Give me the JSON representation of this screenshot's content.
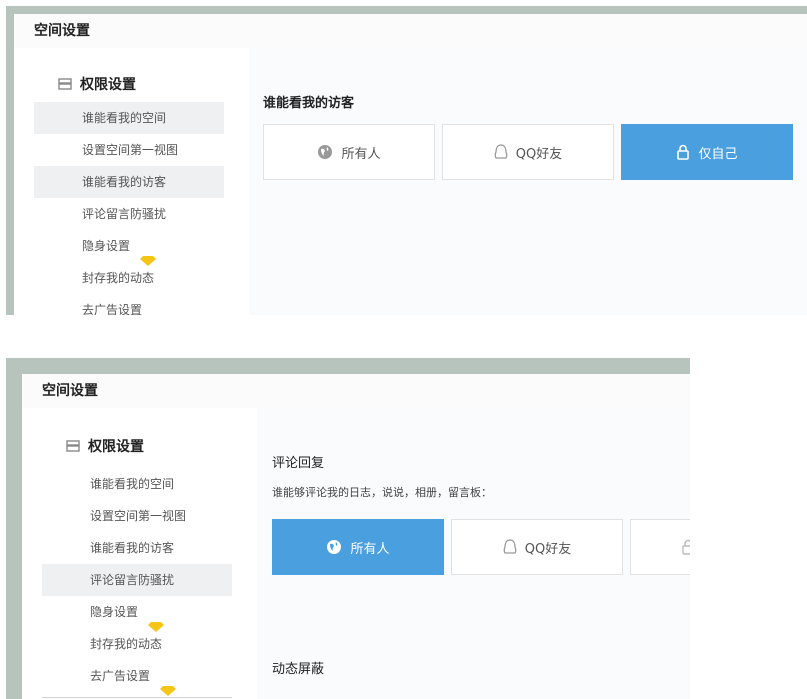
{
  "panels": [
    {
      "header_title": "空间设置",
      "sidebar_heading": "权限设置",
      "sidebar_items": [
        {
          "label": "谁能看我的空间",
          "active": true,
          "premium": false
        },
        {
          "label": "设置空间第一视图",
          "active": false,
          "premium": false
        },
        {
          "label": "谁能看我的访客",
          "active": true,
          "premium": false
        },
        {
          "label": "评论留言防骚扰",
          "active": false,
          "premium": false
        },
        {
          "label": "隐身设置",
          "active": false,
          "premium": true
        },
        {
          "label": "封存我的动态",
          "active": false,
          "premium": false
        },
        {
          "label": "去广告设置",
          "active": false,
          "premium": true
        }
      ],
      "section_title": "谁能看我的访客",
      "options": [
        {
          "label": "所有人",
          "icon": "globe-icon",
          "selected": false
        },
        {
          "label": "QQ好友",
          "icon": "qq-icon",
          "selected": false
        },
        {
          "label": "仅自己",
          "icon": "lock-icon",
          "selected": true
        }
      ]
    },
    {
      "header_title": "空间设置",
      "sidebar_heading": "权限设置",
      "sidebar_items": [
        {
          "label": "谁能看我的空间",
          "active": false,
          "premium": false
        },
        {
          "label": "设置空间第一视图",
          "active": false,
          "premium": false
        },
        {
          "label": "谁能看我的访客",
          "active": false,
          "premium": false
        },
        {
          "label": "评论留言防骚扰",
          "active": true,
          "premium": false
        },
        {
          "label": "隐身设置",
          "active": false,
          "premium": true
        },
        {
          "label": "封存我的动态",
          "active": false,
          "premium": false
        },
        {
          "label": "去广告设置",
          "active": false,
          "premium": true
        }
      ],
      "section_title": "评论回复",
      "section_desc": "谁能够评论我的日志，说说，相册，留言板：",
      "options": [
        {
          "label": "所有人",
          "icon": "globe-icon",
          "selected": true
        },
        {
          "label": "QQ好友",
          "icon": "qq-icon",
          "selected": false
        },
        {
          "label": "",
          "icon": "lock-icon",
          "selected": false
        }
      ],
      "section2_title": "动态屏蔽"
    }
  ],
  "colors": {
    "accent": "#4a9fdf",
    "frame": "#b7c3bd",
    "active_bg": "#eef0f2",
    "diamond": "#f5c518"
  }
}
